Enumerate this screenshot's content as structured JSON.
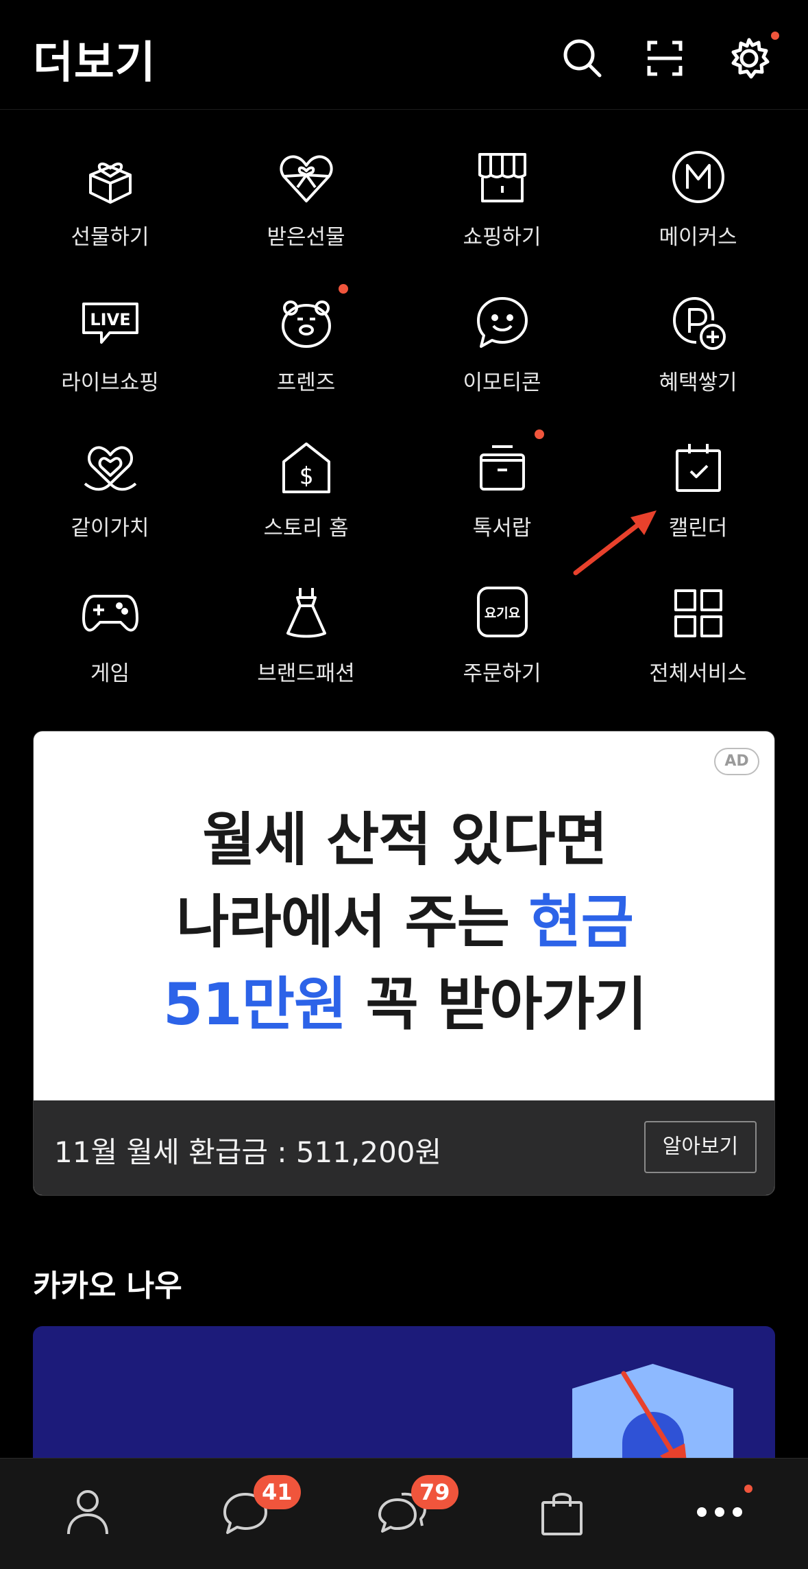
{
  "header": {
    "title": "더보기",
    "icons": [
      "search-icon",
      "scan-icon",
      "gear-icon"
    ]
  },
  "menu": [
    {
      "label": "선물하기",
      "icon": "gift-box-icon"
    },
    {
      "label": "받은선물",
      "icon": "heart-gift-icon"
    },
    {
      "label": "쇼핑하기",
      "icon": "store-icon"
    },
    {
      "label": "메이커스",
      "icon": "makers-icon"
    },
    {
      "label": "라이브쇼핑",
      "icon": "live-icon"
    },
    {
      "label": "프렌즈",
      "icon": "friends-bear-icon"
    },
    {
      "label": "이모티콘",
      "icon": "emoticon-icon"
    },
    {
      "label": "혜택쌓기",
      "icon": "point-plus-icon"
    },
    {
      "label": "같이가치",
      "icon": "together-heart-icon"
    },
    {
      "label": "스토리 홈",
      "icon": "story-home-icon"
    },
    {
      "label": "톡서랍",
      "icon": "drawer-icon"
    },
    {
      "label": "캘린더",
      "icon": "calendar-icon"
    },
    {
      "label": "게임",
      "icon": "gamepad-icon"
    },
    {
      "label": "브랜드패션",
      "icon": "dress-icon"
    },
    {
      "label": "주문하기",
      "icon": "yogiyo-icon",
      "icon_text": "요기요"
    },
    {
      "label": "전체서비스",
      "icon": "grid-icon"
    }
  ],
  "ad": {
    "badge": "AD",
    "line1": "월세 산적 있다면",
    "line2_a": "나라에서 주는 ",
    "line2_b": "현금",
    "line3_a": "51만원",
    "line3_b": " 꼭 받아가기",
    "footer_text": "11월 월세 환급금 : 511,200원",
    "button": "알아보기"
  },
  "kakao_now": {
    "title": "카카오 나우"
  },
  "tabbar": {
    "items": [
      "profile-icon",
      "chat-icon",
      "open-chat-icon",
      "shopping-bag-icon",
      "more-icon"
    ],
    "chat_badge": "41",
    "open_chat_badge": "79"
  },
  "colors": {
    "accent": "#f0553c",
    "ad_blue": "#2c63e8",
    "background": "#000000"
  }
}
